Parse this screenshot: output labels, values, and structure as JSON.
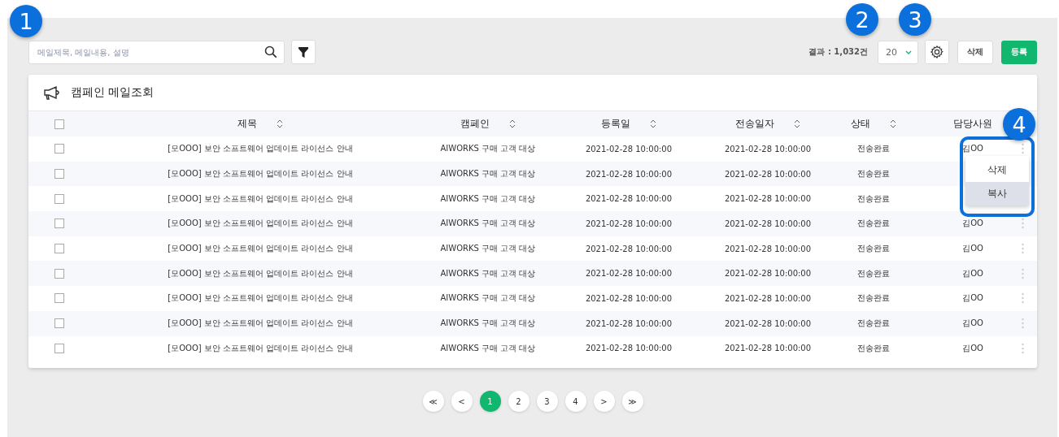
{
  "search": {
    "placeholder": "메일제목, 메일내용, 설명"
  },
  "toolbar": {
    "result": "결과 : 1,032건",
    "page_size": "20",
    "buttons": [
      {
        "label": "삭제",
        "kind": "secondary"
      },
      {
        "label": "등록",
        "kind": "primary"
      }
    ]
  },
  "card": {
    "title": "캠페인 메일조회"
  },
  "table": {
    "header_checked": false,
    "columns": [
      {
        "label": "제목",
        "sortable": true
      },
      {
        "label": "캠페인",
        "sortable": true
      },
      {
        "label": "등록일",
        "sortable": true
      },
      {
        "label": "전송일자",
        "sortable": true
      },
      {
        "label": "상태",
        "sortable": true
      },
      {
        "label": "담당사원",
        "sortable": false
      }
    ],
    "rows": [
      {
        "checked": false,
        "title": "[모OOO] 보안 소프트웨어 업데이트 라이선스 안내",
        "campaign": "AIWORKS 구매 고객 대상",
        "registered": "2021-02-28 10:00:00",
        "sent": "2021-02-28 10:00:00",
        "status": "전송완료",
        "staff": "김OO"
      },
      {
        "checked": false,
        "title": "[모OOO] 보안 소프트웨어 업데이트 라이선스 안내",
        "campaign": "AIWORKS 구매 고객 대상",
        "registered": "2021-02-28 10:00:00",
        "sent": "2021-02-28 10:00:00",
        "status": "전송완료"
      },
      {
        "checked": false,
        "title": "[모OOO] 보안 소프트웨어 업데이트 라이선스 안내",
        "campaign": "AIWORKS 구매 고객 대상",
        "registered": "2021-02-28 10:00:00",
        "sent": "2021-02-28 10:00:00",
        "status": "전송완료"
      },
      {
        "checked": false,
        "title": "[모OOO] 보안 소프트웨어 업데이트 라이선스 안내",
        "campaign": "AIWORKS 구매 고객 대상",
        "registered": "2021-02-28 10:00:00",
        "sent": "2021-02-28 10:00:00",
        "status": "전송완료",
        "staff": "김OO"
      },
      {
        "checked": false,
        "title": "[모OOO] 보안 소프트웨어 업데이트 라이선스 안내",
        "campaign": "AIWORKS 구매 고객 대상",
        "registered": "2021-02-28 10:00:00",
        "sent": "2021-02-28 10:00:00",
        "status": "전송완료",
        "staff": "김OO"
      },
      {
        "checked": false,
        "title": "[모OOO] 보안 소프트웨어 업데이트 라이선스 안내",
        "campaign": "AIWORKS 구매 고객 대상",
        "registered": "2021-02-28 10:00:00",
        "sent": "2021-02-28 10:00:00",
        "status": "전송완료",
        "staff": "김OO"
      },
      {
        "checked": false,
        "title": "[모OOO] 보안 소프트웨어 업데이트 라이선스 안내",
        "campaign": "AIWORKS 구매 고객 대상",
        "registered": "2021-02-28 10:00:00",
        "sent": "2021-02-28 10:00:00",
        "status": "전송완료",
        "staff": "김OO"
      },
      {
        "checked": false,
        "title": "[모OOO] 보안 소프트웨어 업데이트 라이선스 안내",
        "campaign": "AIWORKS 구매 고객 대상",
        "registered": "2021-02-28 10:00:00",
        "sent": "2021-02-28 10:00:00",
        "status": "전송완료",
        "staff": "김OO"
      },
      {
        "checked": false,
        "title": "[모OOO] 보안 소프트웨어 업데이트 라이선스 안내",
        "campaign": "AIWORKS 구매 고객 대상",
        "registered": "2021-02-28 10:00:00",
        "sent": "2021-02-28 10:00:00",
        "status": "전송완료",
        "staff": "김OO"
      }
    ]
  },
  "row_menu": {
    "open": true,
    "items": [
      {
        "label": "삭제",
        "selected": false
      },
      {
        "label": "복사",
        "selected": true
      }
    ]
  },
  "pagination": [
    {
      "label": "≪",
      "selected": false
    },
    {
      "label": "<",
      "selected": false
    },
    {
      "label": "1",
      "selected": true
    },
    {
      "label": "2",
      "selected": false
    },
    {
      "label": "3",
      "selected": false
    },
    {
      "label": "4",
      "selected": false
    },
    {
      "label": ">",
      "selected": false
    },
    {
      "label": "≫",
      "selected": false
    }
  ],
  "callouts": [
    {
      "label": "1"
    },
    {
      "label": "2"
    },
    {
      "label": "3"
    },
    {
      "label": "4"
    }
  ]
}
